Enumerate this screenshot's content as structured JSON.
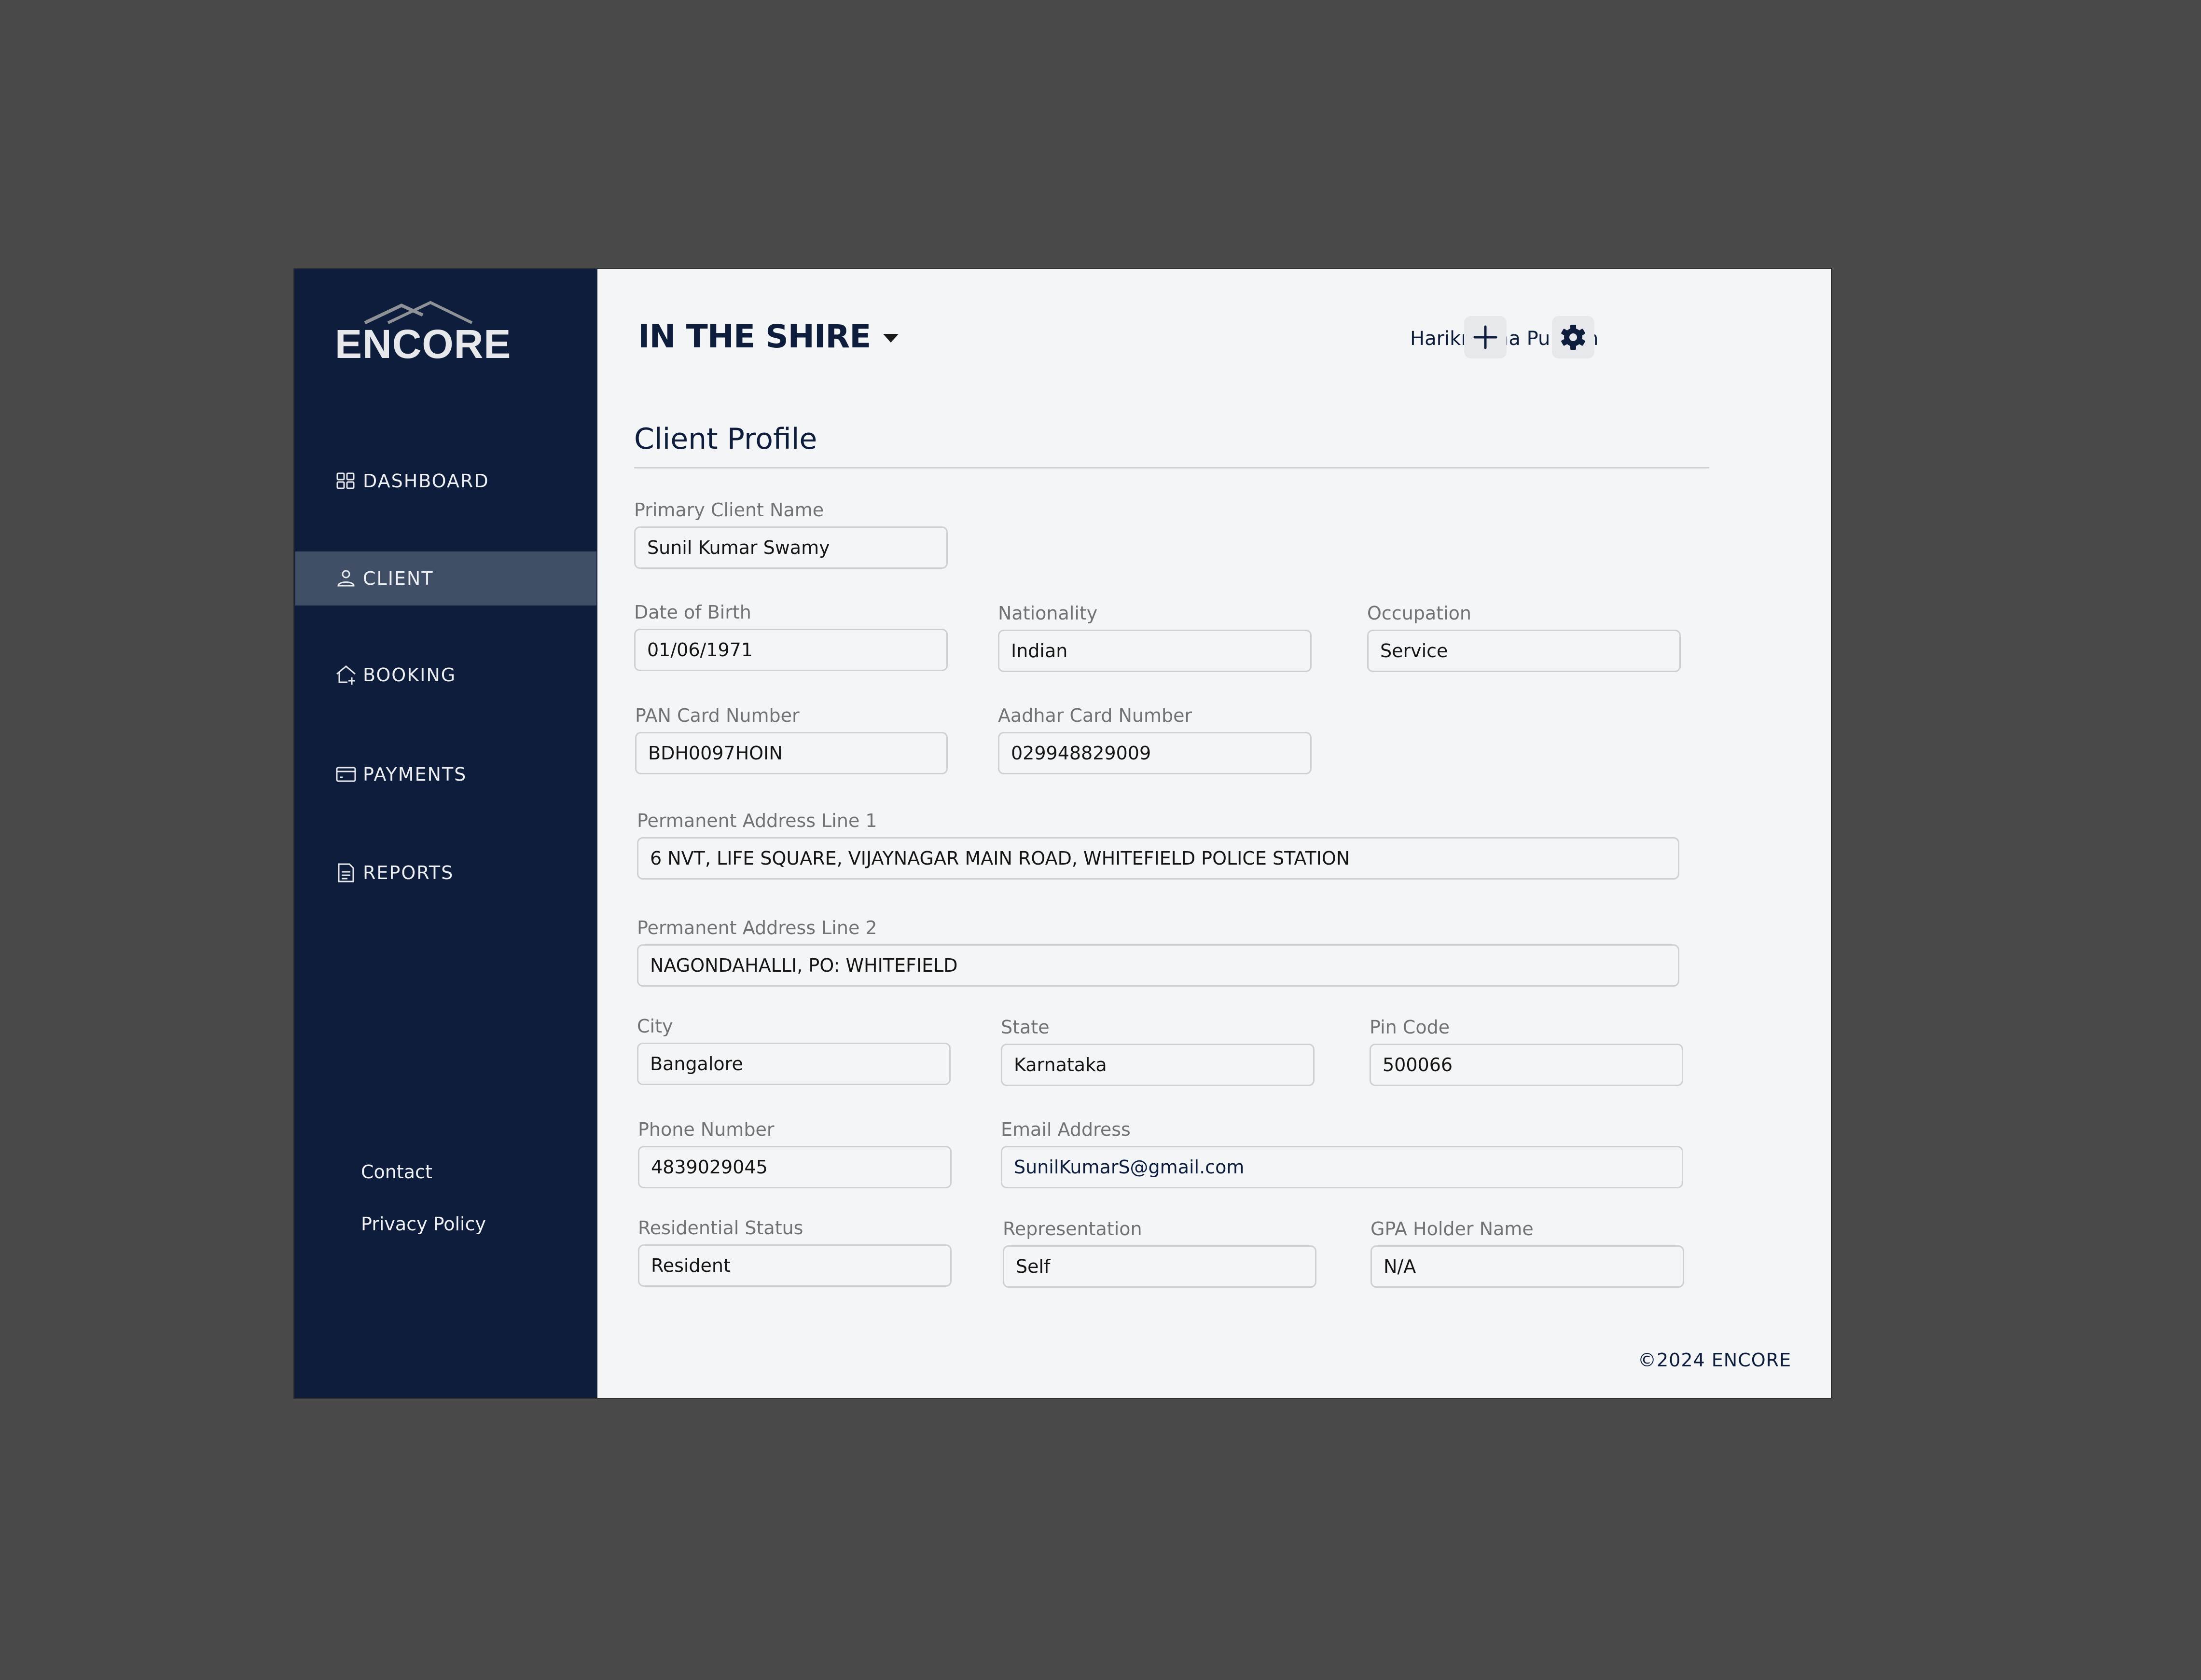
{
  "brand": {
    "logo_text": "ENCORE",
    "copyright": "©2024 ENCORE"
  },
  "colors": {
    "sidebar_bg": "#0d1d3b",
    "sidebar_active": "#414f66",
    "main_bg": "#f4f5f7",
    "accent": "#0d1d3b"
  },
  "sidebar": {
    "items": [
      {
        "label": "DASHBOARD",
        "icon": "grid-icon",
        "active": false
      },
      {
        "label": "CLIENT",
        "icon": "user-icon",
        "active": true
      },
      {
        "label": "BOOKING",
        "icon": "house-plus-icon",
        "active": false
      },
      {
        "label": "PAYMENTS",
        "icon": "credit-card-icon",
        "active": false
      },
      {
        "label": "REPORTS",
        "icon": "document-icon",
        "active": false
      }
    ],
    "footer_links": [
      {
        "label": "Contact"
      },
      {
        "label": "Privacy Policy"
      }
    ]
  },
  "header": {
    "project": "IN THE SHIRE",
    "user_name": "Harikrishna Pulgam",
    "add_icon": "plus-icon",
    "settings_icon": "gear-icon"
  },
  "form": {
    "title": "Client Profile",
    "fields": {
      "primary_client_name": {
        "label": "Primary Client Name",
        "value": "Sunil Kumar Swamy"
      },
      "dob": {
        "label": "Date of Birth",
        "value": "01/06/1971"
      },
      "nationality": {
        "label": "Nationality",
        "value": "Indian"
      },
      "occupation": {
        "label": "Occupation",
        "value": "Service"
      },
      "pan": {
        "label": "PAN Card Number",
        "value": "BDH0097HOIN"
      },
      "aadhar": {
        "label": "Aadhar Card Number",
        "value": "029948829009"
      },
      "address1": {
        "label": "Permanent Address Line 1",
        "value": "6 NVT, LIFE SQUARE, VIJAYNAGAR MAIN ROAD, WHITEFIELD POLICE STATION"
      },
      "address2": {
        "label": "Permanent Address Line 2",
        "value": "NAGONDAHALLI, PO: WHITEFIELD"
      },
      "city": {
        "label": "City",
        "value": "Bangalore"
      },
      "state": {
        "label": "State",
        "value": "Karnataka"
      },
      "pin": {
        "label": "Pin Code",
        "value": "500066"
      },
      "phone": {
        "label": "Phone Number",
        "value": "4839029045"
      },
      "email": {
        "label": "Email Address",
        "value": "SunilKumarS@gmail.com"
      },
      "residential_status": {
        "label": "Residential Status",
        "value": "Resident"
      },
      "representation": {
        "label": "Representation",
        "value": "Self"
      },
      "gpa_holder": {
        "label": "GPA Holder Name",
        "value": "N/A"
      }
    }
  }
}
